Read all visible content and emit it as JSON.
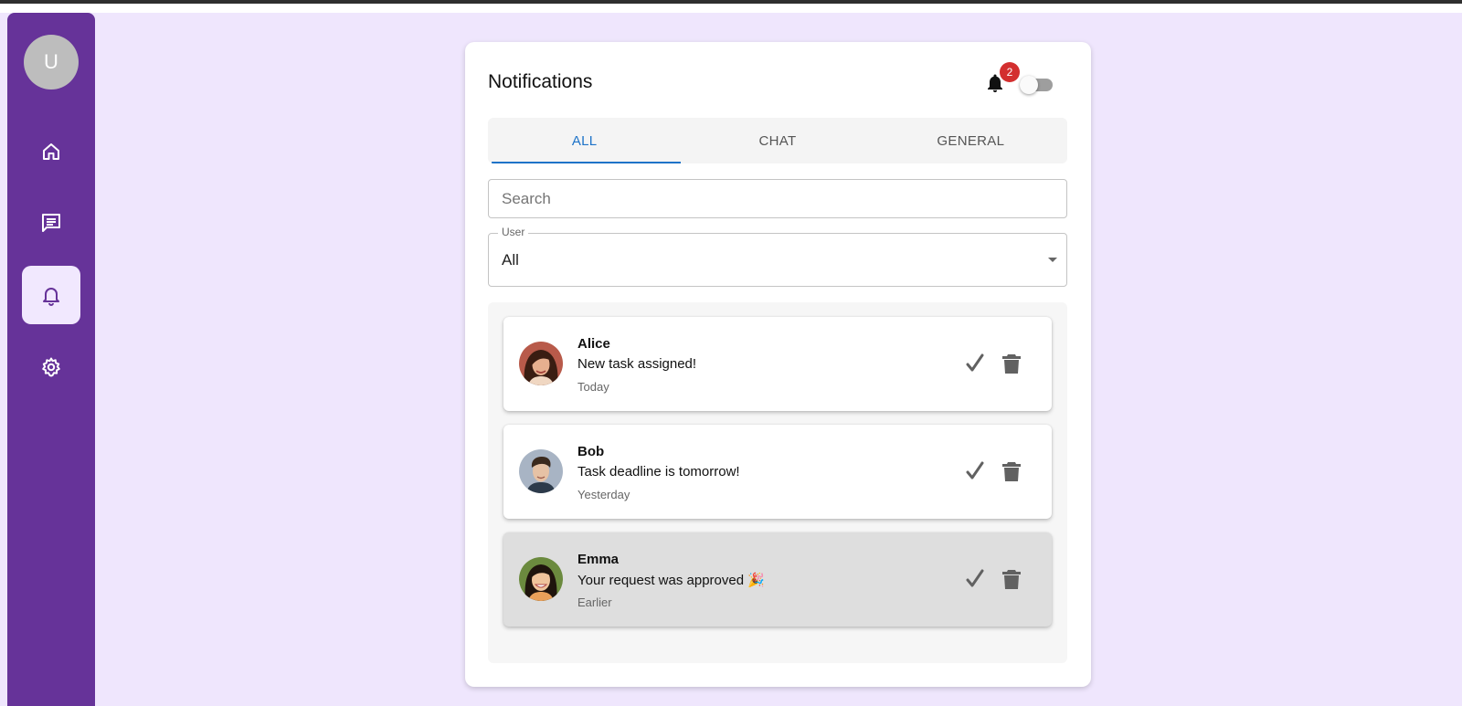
{
  "sidebar": {
    "avatar_letter": "U",
    "items": [
      {
        "icon": "home-icon",
        "active": false
      },
      {
        "icon": "chat-icon",
        "active": false
      },
      {
        "icon": "bell-icon",
        "active": true
      },
      {
        "icon": "gear-icon",
        "active": false
      }
    ]
  },
  "header": {
    "title": "Notifications",
    "badge_count": "2",
    "toggle_on": false
  },
  "tabs": [
    {
      "label": "ALL",
      "active": true
    },
    {
      "label": "CHAT",
      "active": false
    },
    {
      "label": "GENERAL",
      "active": false
    }
  ],
  "search": {
    "placeholder": "Search",
    "value": ""
  },
  "user_filter": {
    "label": "User",
    "value": "All"
  },
  "notifications": [
    {
      "name": "Alice",
      "message": "New task assigned!",
      "time": "Today",
      "read": false
    },
    {
      "name": "Bob",
      "message": "Task deadline is tomorrow!",
      "time": "Yesterday",
      "read": false
    },
    {
      "name": "Emma",
      "message": "Your request was approved 🎉",
      "time": "Earlier",
      "read": true
    }
  ],
  "colors": {
    "sidebar": "#663399",
    "background": "#efe6fd",
    "accent": "#1e73c8",
    "badge": "#d32f2f"
  }
}
